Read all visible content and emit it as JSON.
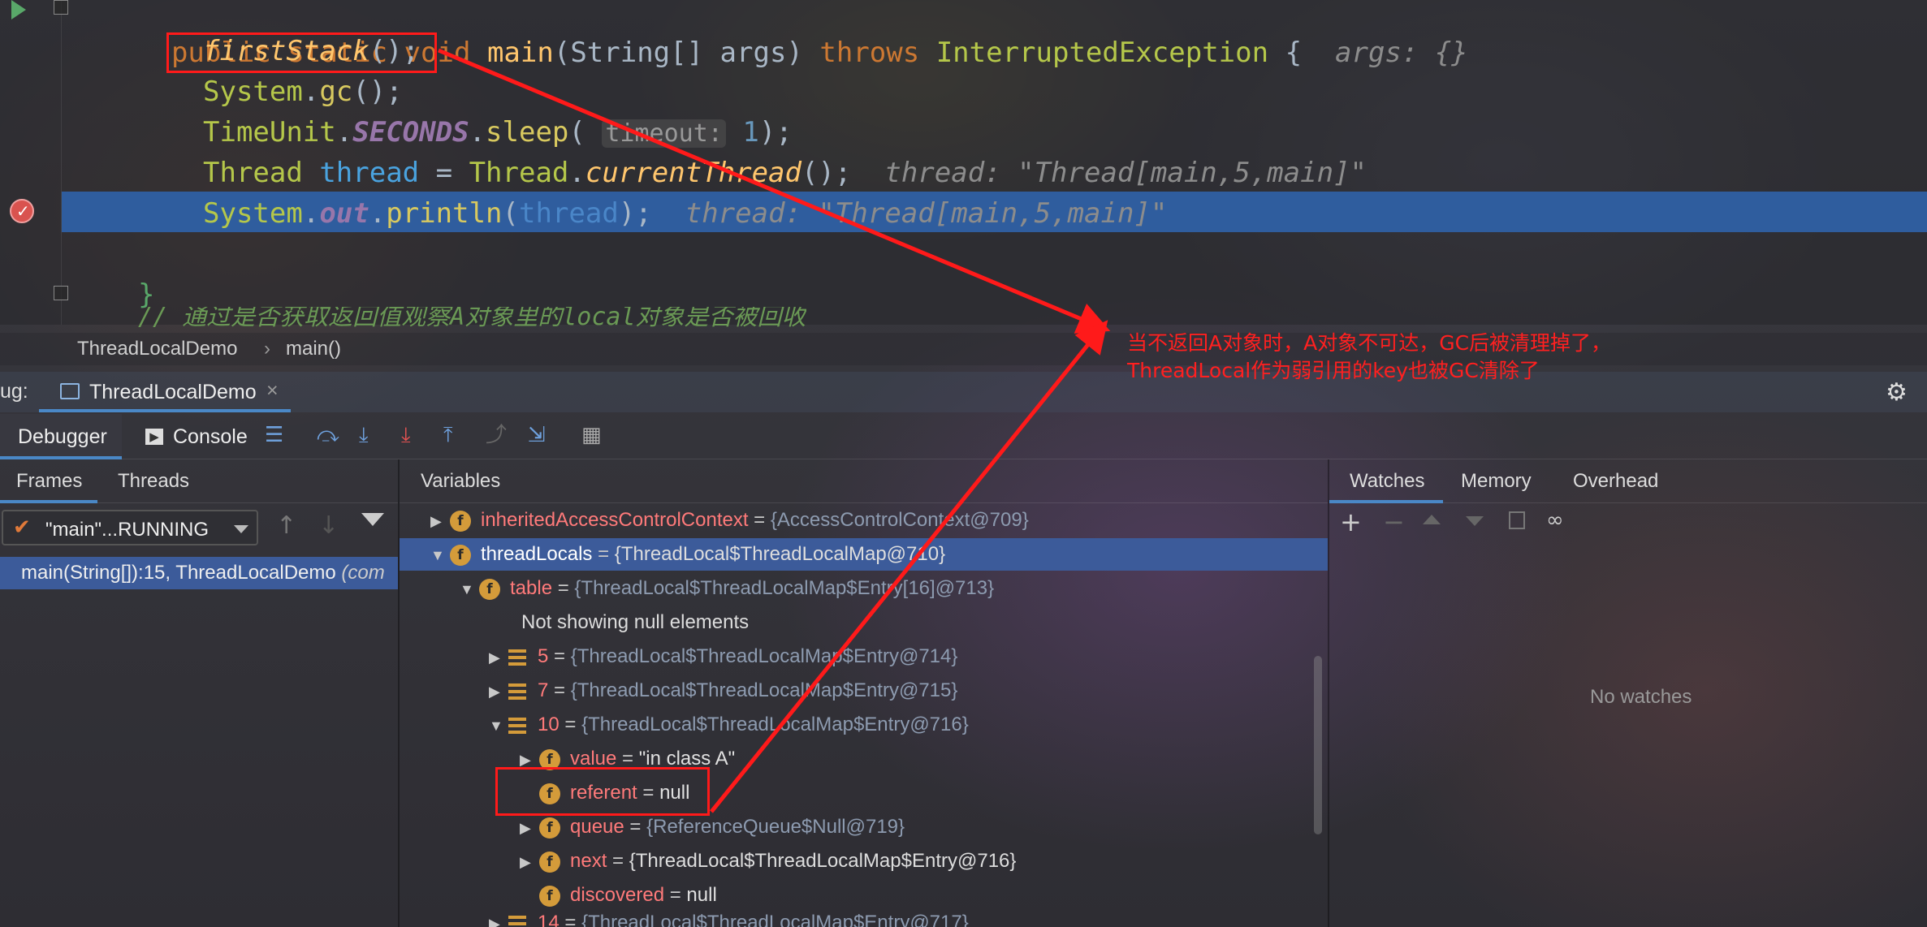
{
  "editor": {
    "line1": {
      "kw1": "public",
      "kw2": "static",
      "kw3": "void",
      "method": "main",
      "params": "(String[] args)",
      "throws": "throws",
      "exc": "InterruptedException",
      "brace": "{",
      "hint": "args: {}"
    },
    "line2": {
      "call": "firstStack",
      "rest": "();"
    },
    "line3": {
      "cls": "System",
      "dot": ".",
      "m": "gc",
      "rest": "();"
    },
    "line4": {
      "cls": "TimeUnit",
      "dot": ".",
      "field": "SECONDS",
      "dot2": ".",
      "m": "sleep",
      "open": "(",
      "hint": "timeout:",
      "num": "1",
      "rest": ");"
    },
    "line5": {
      "cls": "Thread",
      "var": "thread",
      "eq": " = ",
      "cls2": "Thread",
      "dot": ".",
      "m": "currentThread",
      "rest": "();",
      "hint": "thread: \"Thread[main,5,main]\""
    },
    "line6": {
      "cls": "System",
      "dot": ".",
      "field": "out",
      "dot2": ".",
      "m": "println",
      "open": "(",
      "var": "thread",
      "rest": ");",
      "hint": "thread: \"Thread[main,5,main]\""
    },
    "line8": {
      "brace": "}"
    },
    "line9": {
      "comment": "// 通过是否获取返回值观察A对象里的local对象是否被回收"
    }
  },
  "breadcrumb": {
    "class": "ThreadLocalDemo",
    "sep": "›",
    "method": "main()"
  },
  "debug_tab": {
    "prefix": "ug:",
    "title": "ThreadLocalDemo",
    "close": "×"
  },
  "toolbar": {
    "debugger": "Debugger",
    "console": "Console"
  },
  "frames_panel": {
    "tab_frames": "Frames",
    "tab_threads": "Threads",
    "thread_select": "\"main\"...RUNNING",
    "frame": "main(String[]):15, ThreadLocalDemo",
    "frame_suffix": "(com"
  },
  "variables_panel": {
    "title": "Variables",
    "rows": [
      {
        "name": "inheritedAccessControlContext",
        "eq": " = ",
        "val": "{AccessControlContext@709}"
      },
      {
        "name": "threadLocals",
        "eq": " = ",
        "val": "{ThreadLocal$ThreadLocalMap@710}"
      },
      {
        "name": "table",
        "eq": " = ",
        "val": "{ThreadLocal$ThreadLocalMap$Entry[16]@713}"
      },
      {
        "text": "Not showing null elements"
      },
      {
        "name": "5",
        "eq": " = ",
        "val": "{ThreadLocal$ThreadLocalMap$Entry@714}"
      },
      {
        "name": "7",
        "eq": " = ",
        "val": "{ThreadLocal$ThreadLocalMap$Entry@715}"
      },
      {
        "name": "10",
        "eq": " = ",
        "val": "{ThreadLocal$ThreadLocalMap$Entry@716}"
      },
      {
        "name": "value",
        "eq": " = ",
        "val": "\"in class A\""
      },
      {
        "name": "referent",
        "eq": " = ",
        "val": "null"
      },
      {
        "name": "queue",
        "eq": " = ",
        "val": "{ReferenceQueue$Null@719}"
      },
      {
        "name": "next",
        "eq": " = ",
        "val": "{ThreadLocal$ThreadLocalMap$Entry@716}"
      },
      {
        "name": "discovered",
        "eq": " = ",
        "val": "null"
      },
      {
        "name": "14",
        "eq": " = ",
        "val": "{ThreadLocal$ThreadLocalMap$Entry@717}"
      }
    ]
  },
  "watches_panel": {
    "tab_watches": "Watches",
    "tab_memory": "Memory",
    "tab_overhead": "Overhead",
    "empty": "No watches"
  },
  "annotation": {
    "line1": "当不返回A对象时，A对象不可达，GC后被清理掉了，",
    "line2": "ThreadLocal作为弱引用的key也被GC清除了"
  },
  "colors": {
    "highlight": "#2f5d9e",
    "annotation": "#ff1a1a",
    "field_icon": "#d49b3a"
  }
}
